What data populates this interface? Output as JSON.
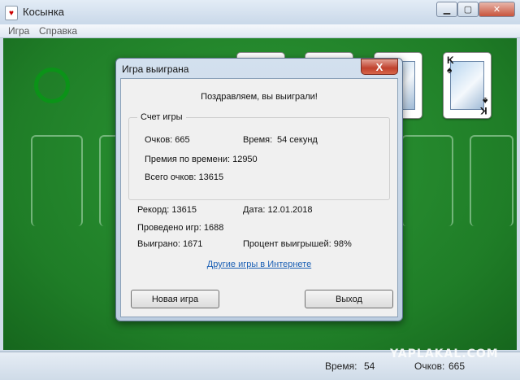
{
  "window": {
    "title": "Косынка"
  },
  "menu": [
    "Игра",
    "Справка"
  ],
  "cards": {
    "foundation_top": {
      "rank": "K",
      "suit": "♠"
    }
  },
  "status": {
    "time_label": "Время:",
    "time_value": "54",
    "score_label": "Очков:",
    "score_value": "665"
  },
  "watermark": "YAPLAKAL.COM",
  "dialog": {
    "title": "Игра выиграна",
    "close": "X",
    "congrats": "Поздравляем, вы выиграли!",
    "group_title": "Счет игры",
    "points": "Очков: 665",
    "time": "Время:",
    "time_value": "54 секунд",
    "time_bonus": "Премия по времени: 12950",
    "total": "Всего очков: 13615",
    "record": "Рекорд: 13615",
    "date": "Дата: 12.01.2018",
    "played": "Проведено игр: 1688",
    "won": "Выиграно: 1671",
    "win_percent": "Процент выигрышей: 98%",
    "link": "Другие игры в Интернете",
    "new_game": "Новая игра",
    "exit": "Выход"
  }
}
